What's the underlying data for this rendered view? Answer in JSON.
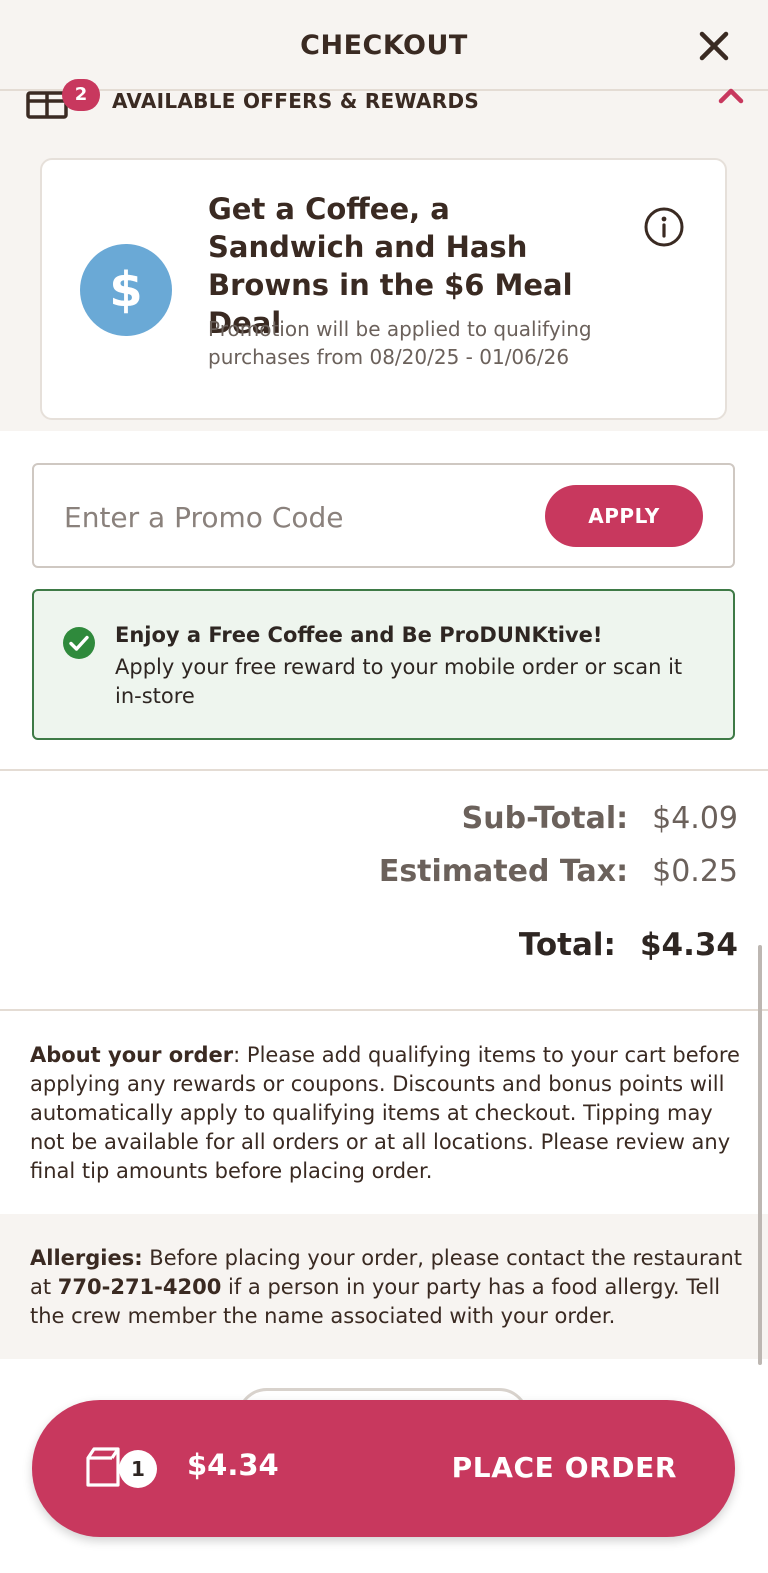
{
  "header": {
    "title": "CHECKOUT"
  },
  "offers": {
    "count": "2",
    "label": "AVAILABLE OFFERS & REWARDS",
    "card": {
      "icon_symbol": "$",
      "title": "Get a Coffee, a Sandwich and Hash Browns in the $6 Meal Deal",
      "description": "Promotion will be applied to qualifying purchases from 08/20/25 - 01/06/26"
    }
  },
  "promo": {
    "placeholder": "Enter a Promo Code",
    "apply_label": "APPLY"
  },
  "reward_notice": {
    "title": "Enjoy a Free Coffee and Be ProDUNKtive!",
    "description": "Apply your free reward to your mobile order or scan it in-store"
  },
  "totals": {
    "subtotal_label": "Sub-Total:",
    "subtotal_value": "$4.09",
    "tax_label": "Estimated Tax:",
    "tax_value": "$0.25",
    "total_label": "Total:",
    "total_value": "$4.34"
  },
  "about": {
    "heading": "About your order",
    "text": ": Please add qualifying items to your cart before applying any rewards or coupons. Discounts and bonus points will automatically apply to qualifying items at checkout. Tipping may not be available for all orders or at all locations. Please review any final tip amounts before placing order."
  },
  "allergies": {
    "heading": "Allergies:",
    "text_before": " Before placing your order, please contact the restaurant at ",
    "phone": "770-271-4200",
    "text_after": " if a person in your party has a food allergy. Tell the crew member the name associated with your order."
  },
  "place_order": {
    "item_count": "1",
    "amount": "$4.34",
    "label": "PLACE ORDER"
  },
  "colors": {
    "brand_pink": "#c8385e",
    "dollar_blue": "#6aa9d6",
    "success_green": "#3e7a46",
    "header_bg": "#f7f4f1"
  },
  "icons": [
    "close-icon",
    "gift-icon",
    "chevron-up-icon",
    "dollar-icon",
    "info-icon",
    "check-circle-icon",
    "bag-icon"
  ]
}
